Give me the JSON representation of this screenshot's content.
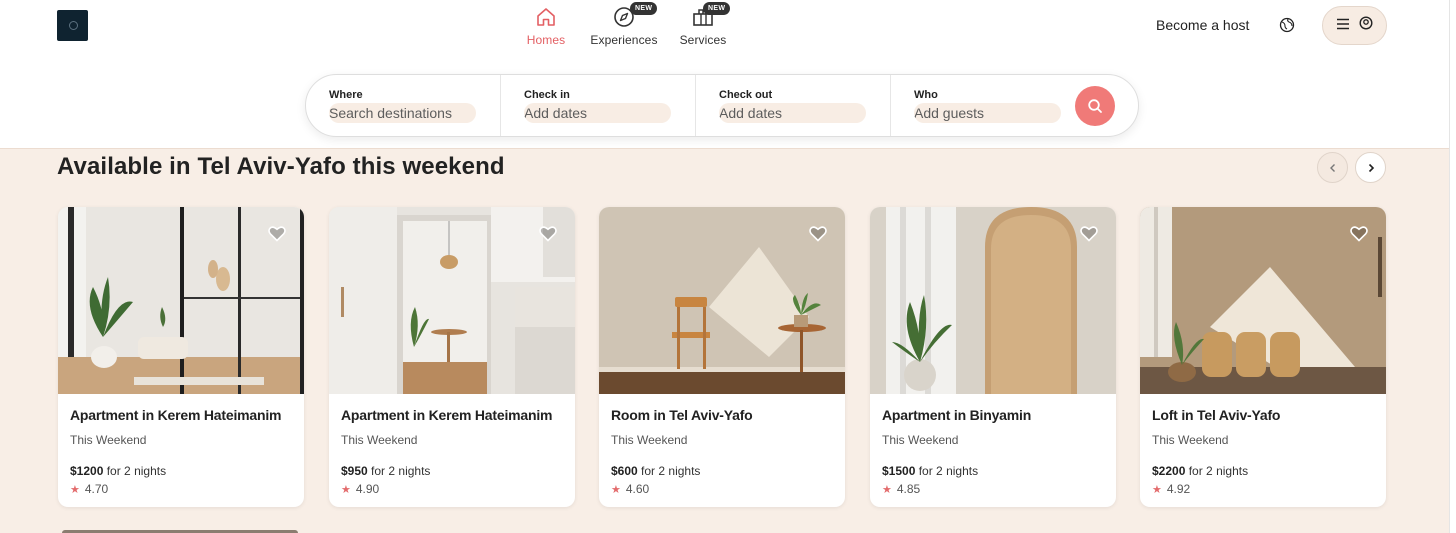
{
  "nav": {
    "homes": "Homes",
    "experiences": "Experiences",
    "services": "Services",
    "new_badge": "NEW",
    "active_color": "#e35f63"
  },
  "header": {
    "become_host": "Become a host"
  },
  "search": {
    "where_label": "Where",
    "where_placeholder": "Search destinations",
    "checkin_label": "Check in",
    "checkin_placeholder": "Add dates",
    "checkout_label": "Check out",
    "checkout_placeholder": "Add dates",
    "who_label": "Who",
    "who_placeholder": "Add guests",
    "button_color": "#f07a78"
  },
  "section": {
    "title": "Available in Tel Aviv-Yafo this weekend"
  },
  "listings": [
    {
      "title": "Apartment in Kerem Hateimanim",
      "subtitle": "This Weekend",
      "price": "$1200",
      "price_suffix": "for 2 nights",
      "rating": "4.70"
    },
    {
      "title": "Apartment in Kerem Hateimanim",
      "subtitle": "This Weekend",
      "price": "$950",
      "price_suffix": "for 2 nights",
      "rating": "4.90"
    },
    {
      "title": "Room in Tel Aviv-Yafo",
      "subtitle": "This Weekend",
      "price": "$600",
      "price_suffix": "for 2 nights",
      "rating": "4.60"
    },
    {
      "title": "Apartment in Binyamin",
      "subtitle": "This Weekend",
      "price": "$1500",
      "price_suffix": "for 2 nights",
      "rating": "4.85"
    },
    {
      "title": "Loft in Tel Aviv-Yafo",
      "subtitle": "This Weekend",
      "price": "$2200",
      "price_suffix": "for 2 nights",
      "rating": "4.92"
    }
  ]
}
